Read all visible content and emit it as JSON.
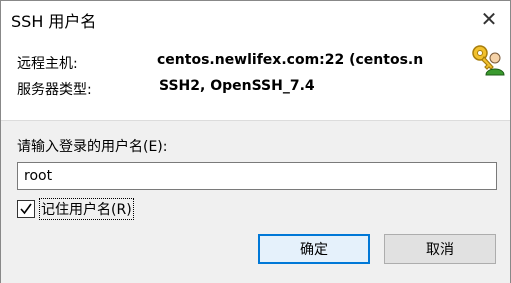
{
  "window": {
    "title": "SSH 用户名",
    "close_glyph": "✕"
  },
  "info": {
    "host_label": "远程主机:",
    "host_value": "centos.newlifex.com:22 (centos.n",
    "server_type_label": "服务器类型:",
    "server_type_value": "SSH2, OpenSSH_7.4"
  },
  "form": {
    "username_label": "请输入登录的用户名(E):",
    "username_value": "root",
    "remember_checked": true,
    "remember_label": "记住用户名(R)"
  },
  "buttons": {
    "ok_label": "确定",
    "cancel_label": "取消"
  },
  "icons": {
    "key_user": "key-user-icon"
  },
  "colors": {
    "ok_border": "#0078d7",
    "panel_bg": "#f0f0f0"
  }
}
